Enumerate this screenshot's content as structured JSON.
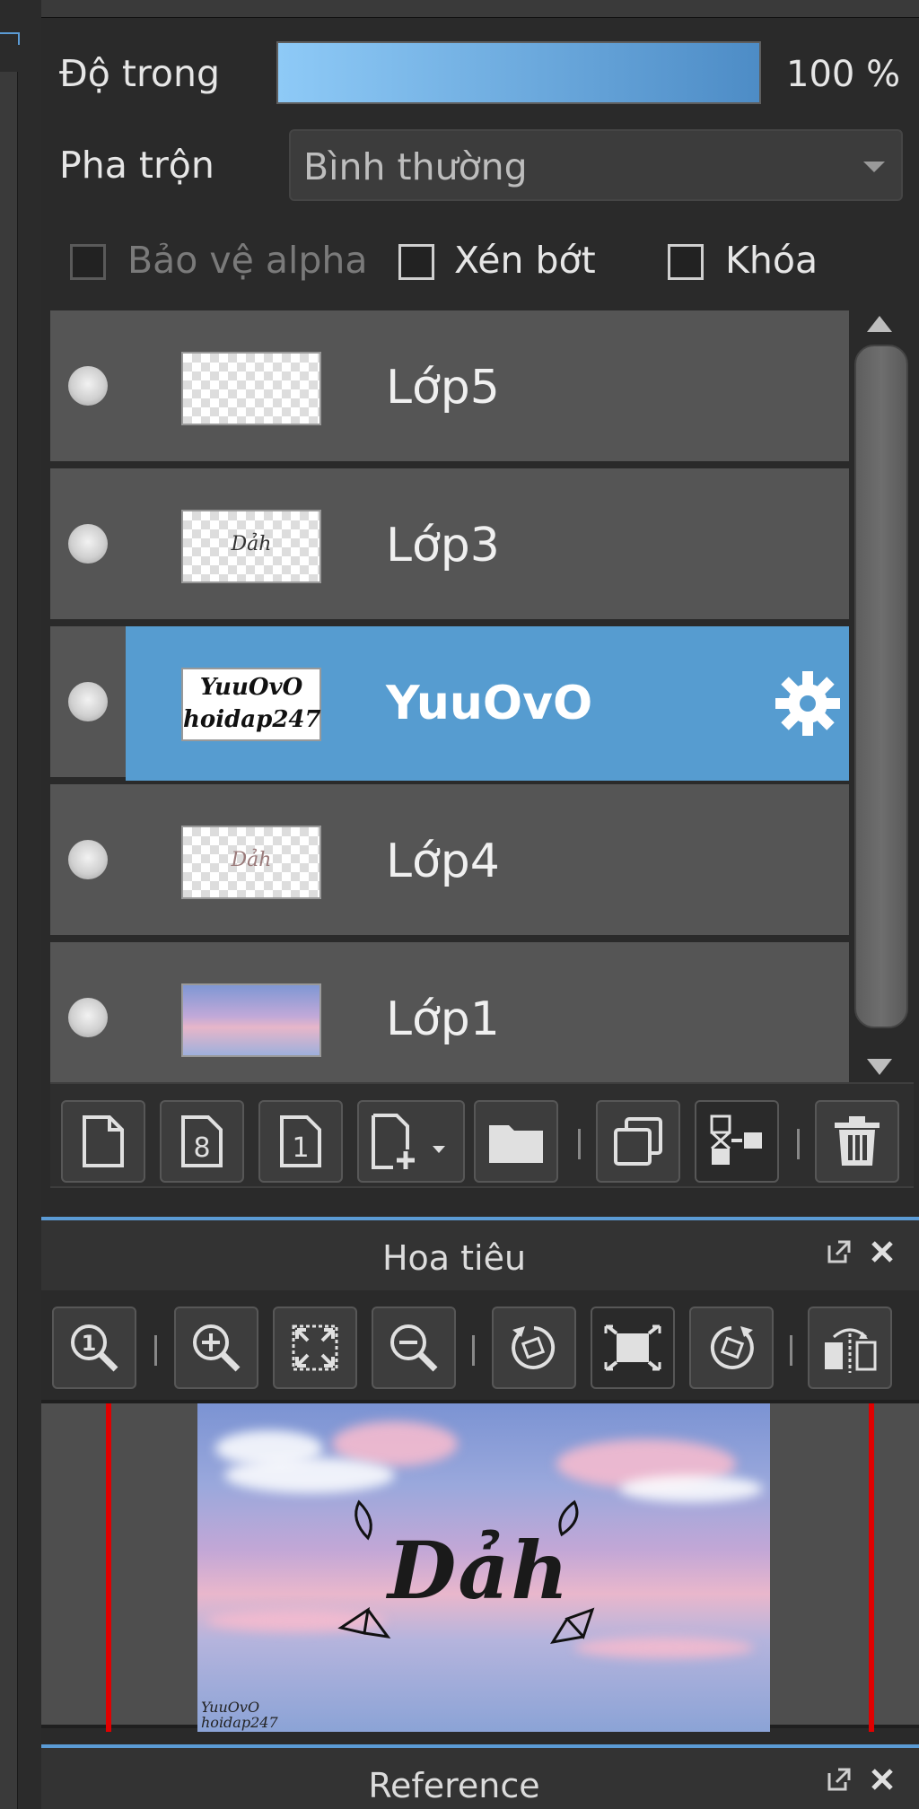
{
  "layer_panel": {
    "opacity_label": "Độ trong",
    "opacity_value": "100 %",
    "opacity_fraction": 1.0,
    "blend_label": "Pha trộn",
    "blend_value": "Bình thường",
    "options": {
      "protect_alpha": "Bảo vệ alpha",
      "clipping": "Xén bớt",
      "lock": "Khóa"
    },
    "layers": [
      {
        "name": "Lớp5",
        "thumb_text": ""
      },
      {
        "name": "Lớp3",
        "thumb_text": "Dảh"
      },
      {
        "name": "YuuOvO",
        "thumb_line1": "YuuOvO",
        "thumb_line2": "hoidap247",
        "selected": true
      },
      {
        "name": "Lớp4",
        "thumb_text": "Dảh"
      },
      {
        "name": "Lớp1",
        "thumb_text": ""
      }
    ],
    "toolbar_icons": [
      "new-layer-icon",
      "new-8bit-layer-icon",
      "new-1bit-layer-icon",
      "add-layer-menu-icon",
      "new-folder-icon",
      "duplicate-layer-icon",
      "merge-down-icon",
      "delete-layer-icon"
    ]
  },
  "navigator": {
    "title": "Hoa tiêu",
    "canvas_text": "Dảh",
    "watermark_line1": "YuuOvO",
    "watermark_line2": "hoidap247",
    "toolbar_icons": [
      "zoom-actual-icon",
      "zoom-in-icon",
      "fit-icon",
      "zoom-out-icon",
      "rotate-left-icon",
      "reset-rotation-icon",
      "rotate-right-icon",
      "flip-horizontal-icon"
    ]
  },
  "reference": {
    "title": "Reference"
  },
  "colors": {
    "accent": "#569cd0",
    "panel_bg": "#2a2a2a",
    "layer_bg": "#555555",
    "guide_red": "#e00000"
  }
}
